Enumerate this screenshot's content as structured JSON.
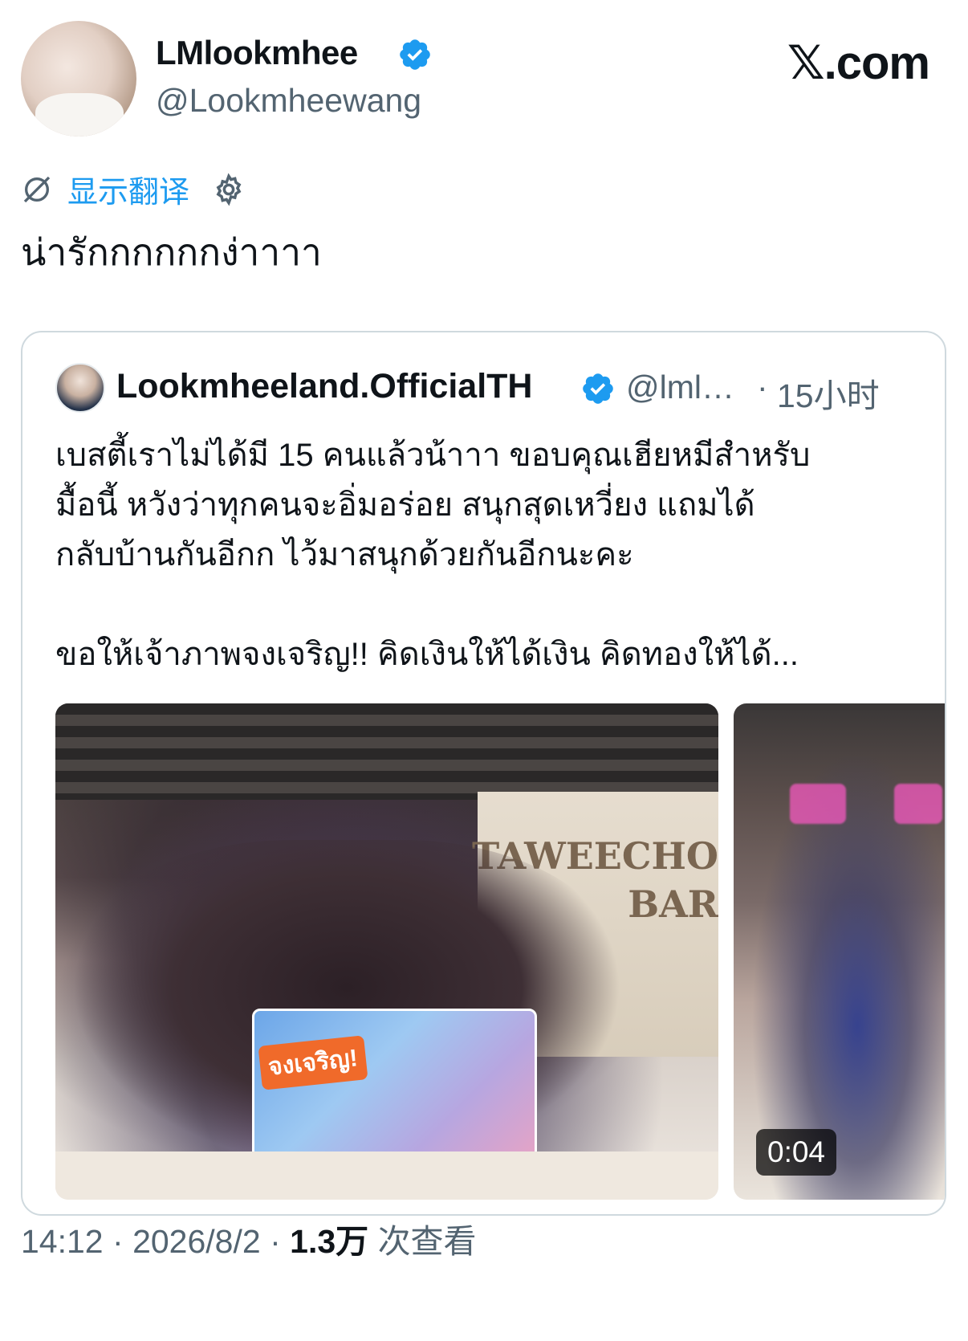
{
  "header": {
    "display_name": "LMlookmhee",
    "handle": "@Lookmheewang",
    "site_logo": "𝕏.com",
    "verified_icon": "verified-badge-icon"
  },
  "translate": {
    "icon": "globe-slash-icon",
    "label": "显示翻译",
    "settings_icon": "gear-icon"
  },
  "tweet": {
    "text": "น่ารักกกกกกง่าาาา"
  },
  "quote": {
    "name": "Lookmheeland.OfficialTH",
    "handle": "@lml…",
    "separator": "·",
    "time": "15小时",
    "lines": [
      "เบสตี้เราไม่ได้มี 15 คนแล้วน้าาา ขอบคุณเฮียหมีสำหรับ",
      "มื้อนี้ หวังว่าทุกคนจะอิ่มอร่อย สนุกสุดเหวี่ยง แถมได้",
      "กลับบ้านกันอีกก ไว้มาสนุกด้วยกันอีกนะคะ",
      "ขอให้เจ้าภาพจงเจริญ!! คิดเงินให้ได้เงิน คิดทองให้ได้..."
    ],
    "media": {
      "photo_sign": [
        "TAWEECHO",
        "BAR"
      ],
      "banner_text": "จงเจริญ!",
      "video_duration": "0:04"
    }
  },
  "meta": {
    "time": "14:12",
    "dot1": "·",
    "date": "2026/8/2",
    "dot2": "·",
    "views_count": "1.3万",
    "views_label": "次查看"
  },
  "colors": {
    "accent": "#1d9bf0",
    "secondary_text": "#536471",
    "border": "#cfd9de"
  }
}
